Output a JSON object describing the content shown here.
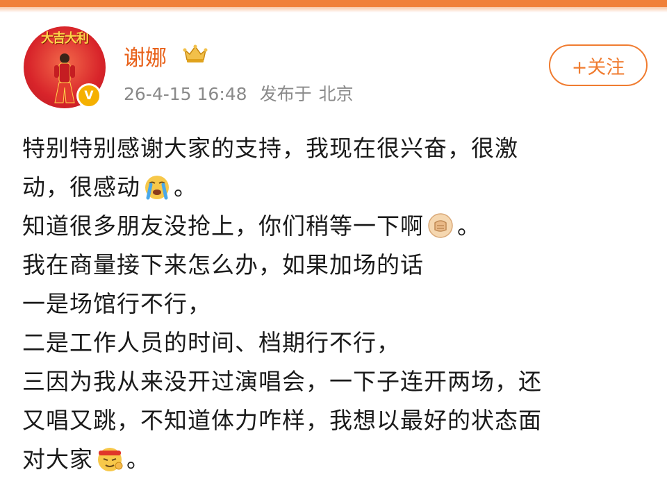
{
  "post": {
    "author": {
      "name": "谢娜",
      "avatar_banner_text": "大吉大利",
      "verified_mark": "V"
    },
    "time": "26-4-15 16:48",
    "published_at_label": "发布于",
    "location": "北京",
    "follow_label": "+关注",
    "lines": [
      {
        "text": "特别特别感谢大家的支持，我现在很兴奋，很激",
        "suffix": ""
      },
      {
        "text": "动，很感动",
        "emoji": "crying-face-icon",
        "suffix": "。"
      },
      {
        "text": "知道很多朋友没抢上，你们稍等一下啊",
        "emoji": "fist-icon",
        "suffix": "。"
      },
      {
        "text": "我在商量接下来怎么办，如果加场的话",
        "suffix": ""
      },
      {
        "text": "一是场馆行不行，",
        "suffix": ""
      },
      {
        "text": "二是工作人员的时间、档期行不行，",
        "suffix": ""
      },
      {
        "text": "三因为我从来没开过演唱会，一下子连开两场，还",
        "suffix": ""
      },
      {
        "text": "又唱又跳，不知道体力咋样，我想以最好的状态面",
        "suffix": ""
      },
      {
        "text": "对大家",
        "emoji": "determined-face-icon",
        "suffix": "。"
      }
    ]
  },
  "colors": {
    "accent": "#f07c30",
    "username": "#e8621b",
    "meta": "#8a8a8a",
    "top_bar": "#f0813a"
  }
}
